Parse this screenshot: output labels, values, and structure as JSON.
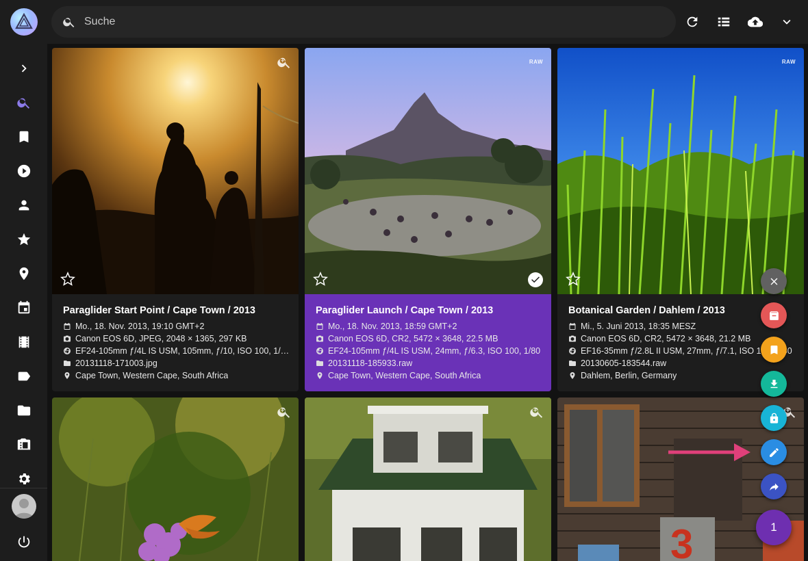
{
  "search": {
    "placeholder": "Suche",
    "value": ""
  },
  "sidebar": {
    "items": [
      {
        "icon": "chevron-right-icon",
        "label": "Expand"
      },
      {
        "icon": "search-icon",
        "label": "Search"
      },
      {
        "icon": "bookmark-icon",
        "label": "Albums"
      },
      {
        "icon": "play-icon",
        "label": "Videos"
      },
      {
        "icon": "person-icon",
        "label": "People"
      },
      {
        "icon": "star-icon",
        "label": "Favorites"
      },
      {
        "icon": "place-icon",
        "label": "Places"
      },
      {
        "icon": "calendar-icon",
        "label": "Calendar"
      },
      {
        "icon": "film-icon",
        "label": "Moments"
      },
      {
        "icon": "label-icon",
        "label": "Labels"
      },
      {
        "icon": "folder-icon",
        "label": "Folders"
      },
      {
        "icon": "library-icon",
        "label": "Library"
      },
      {
        "icon": "gear-icon",
        "label": "Settings"
      }
    ],
    "active": "search-icon"
  },
  "toolbar": {
    "buttons": [
      "refresh-icon",
      "list-view-icon",
      "cloud-upload-icon",
      "chevron-down-icon"
    ]
  },
  "photos": [
    {
      "title": "Paraglider Start Point / Cape Town / 2013",
      "date": "Mo., 18. Nov. 2013, 19:10 GMT+2",
      "camera": "Canon EOS 6D, JPEG, 2048 × 1365, 297 KB",
      "lens": "EF24-105mm ƒ/4L IS USM, 105mm, ƒ/10, ISO 100, 1/…",
      "file": "20131118-171003.jpg",
      "location": "Cape Town, Western Cape, South Africa",
      "badge": "",
      "selected": false
    },
    {
      "title": "Paraglider Launch / Cape Town / 2013",
      "date": "Mo., 18. Nov. 2013, 18:59 GMT+2",
      "camera": "Canon EOS 6D, CR2, 5472 × 3648, 22.5 MB",
      "lens": "EF24-105mm ƒ/4L IS USM, 24mm, ƒ/6.3, ISO 100, 1/80",
      "file": "20131118-185933.raw",
      "location": "Cape Town, Western Cape, South Africa",
      "badge": "RAW",
      "selected": true
    },
    {
      "title": "Botanical Garden / Dahlem / 2013",
      "date": "Mi., 5. Juni 2013, 18:35 MESZ",
      "camera": "Canon EOS 6D, CR2, 5472 × 3648, 21.2 MB",
      "lens": "EF16-35mm ƒ/2.8L II USM, 27mm, ƒ/7.1, ISO 100, 1/80",
      "file": "20130605-183544.raw",
      "location": "Dahlem, Berlin, Germany",
      "badge": "RAW",
      "selected": false
    }
  ],
  "fab": {
    "count": "1",
    "actions": [
      {
        "icon": "close-icon",
        "color": "#616161"
      },
      {
        "icon": "archive-icon",
        "color": "#e45757"
      },
      {
        "icon": "bookmark-icon",
        "color": "#f3a21c"
      },
      {
        "icon": "download-icon",
        "color": "#14b89a"
      },
      {
        "icon": "lock-icon",
        "color": "#18b4d6"
      },
      {
        "icon": "edit-icon",
        "color": "#2a8de3"
      },
      {
        "icon": "share-icon",
        "color": "#3b53c4"
      }
    ],
    "main_color": "#6e2fb0"
  },
  "colors": {
    "accent": "#8c7bea",
    "selected_card": "#6a32b7",
    "highlight_arrow": "#e0407a"
  }
}
